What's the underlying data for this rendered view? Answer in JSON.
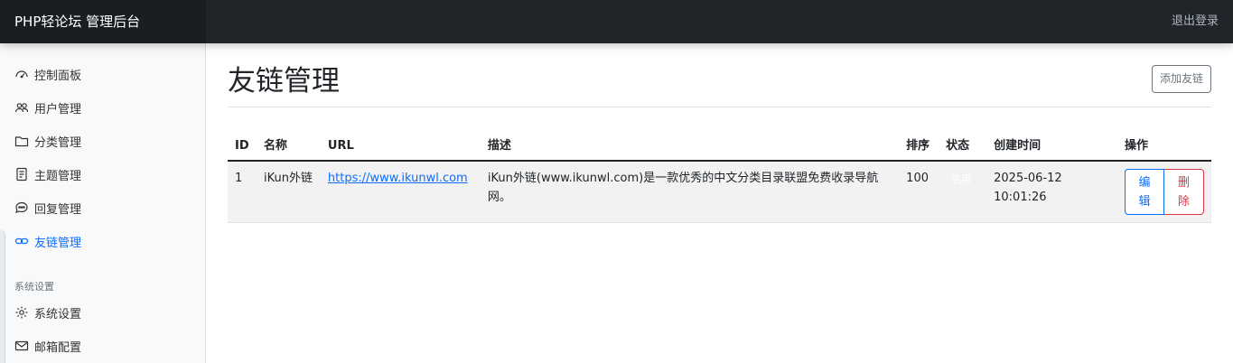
{
  "header": {
    "brand": "PHP轻论坛 管理后台",
    "logout_label": "退出登录"
  },
  "sidebar": {
    "items": [
      {
        "label": "控制面板",
        "icon": "speedometer-icon"
      },
      {
        "label": "用户管理",
        "icon": "people-icon"
      },
      {
        "label": "分类管理",
        "icon": "folder-icon"
      },
      {
        "label": "主题管理",
        "icon": "file-text-icon"
      },
      {
        "label": "回复管理",
        "icon": "chat-dots-icon"
      },
      {
        "label": "友链管理",
        "icon": "link-icon",
        "active": true
      }
    ],
    "section_heading": "系统设置",
    "system_items": [
      {
        "label": "系统设置",
        "icon": "gear-icon"
      },
      {
        "label": "邮箱配置",
        "icon": "envelope-icon"
      }
    ]
  },
  "main": {
    "title": "友链管理",
    "add_button": "添加友链",
    "table": {
      "headers": {
        "id": "ID",
        "name": "名称",
        "url": "URL",
        "desc": "描述",
        "order": "排序",
        "status": "状态",
        "created": "创建时间",
        "actions": "操作"
      },
      "rows": [
        {
          "id": "1",
          "name": "iKun外链",
          "url": "https://www.ikunwl.com",
          "desc": "iKun外链(www.ikunwl.com)是一款优秀的中文分类目录联盟免费收录导航网。",
          "order": "100",
          "status": "启用",
          "created": "2025-06-12 10:01:26",
          "edit_label": "编辑",
          "delete_label": "删除"
        }
      ]
    }
  },
  "colors": {
    "accent": "#0d6efd",
    "danger": "#dc3545",
    "topbar": "#212529"
  }
}
